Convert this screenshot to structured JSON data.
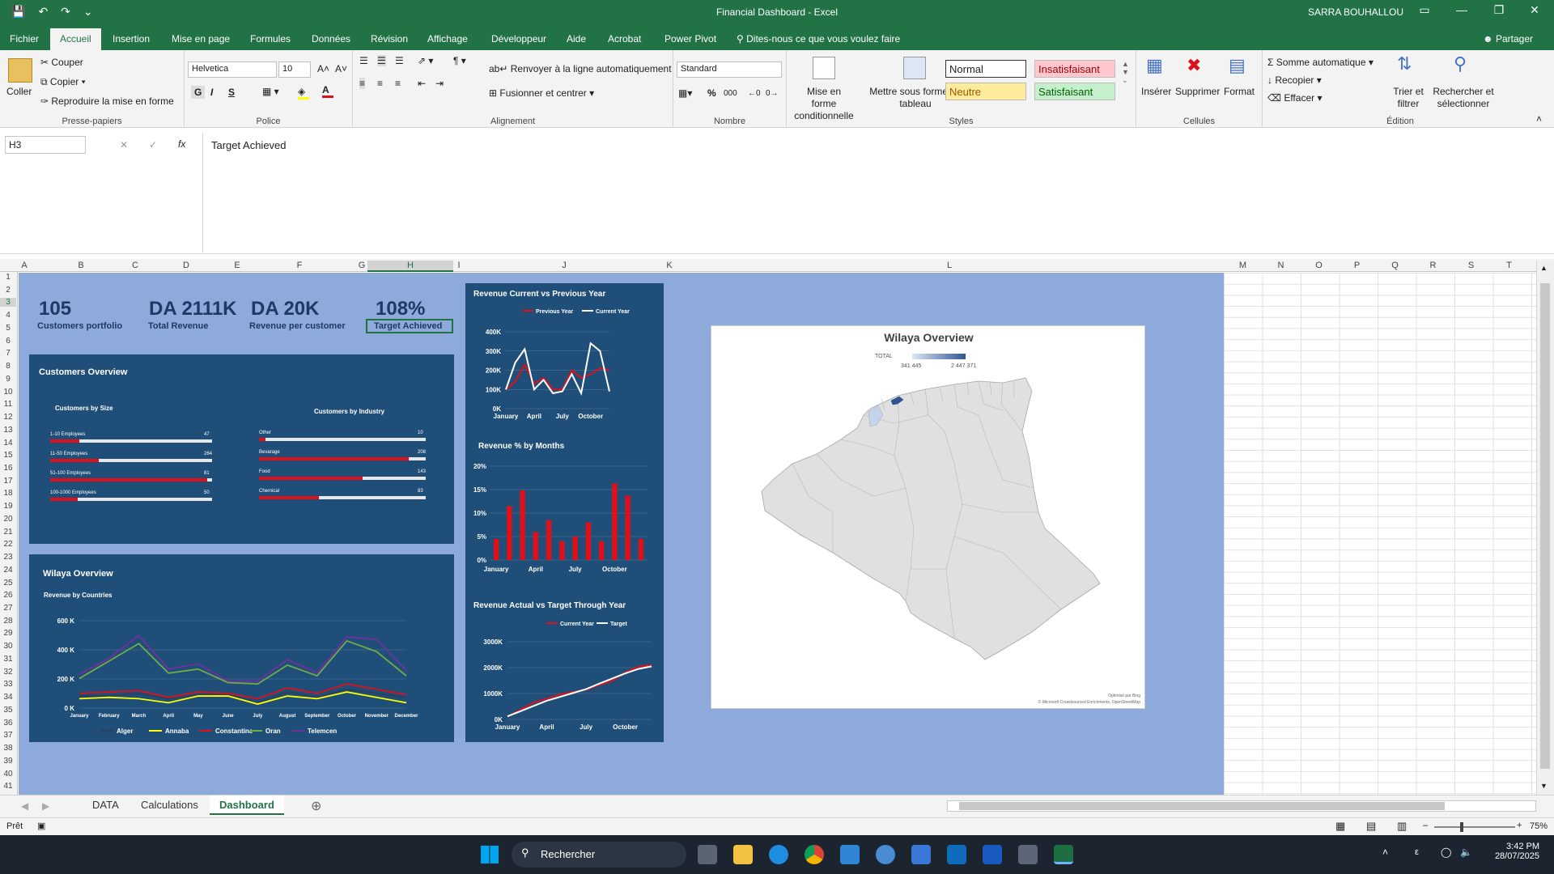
{
  "window": {
    "title": "Financial Dashboard  -  Excel",
    "user": "SARRA BOUHALLOU",
    "share": "Partager",
    "tell_me": "Dites-nous ce que vous voulez faire"
  },
  "menu": [
    "Fichier",
    "Accueil",
    "Insertion",
    "Mise en page",
    "Formules",
    "Données",
    "Révision",
    "Affichage",
    "Développeur",
    "Aide",
    "Acrobat",
    "Power Pivot"
  ],
  "ribbon": {
    "clipboard": {
      "paste": "Coller",
      "cut": "Couper",
      "copy": "Copier",
      "format_painter": "Reproduire la mise en forme",
      "label": "Presse-papiers"
    },
    "font": {
      "name": "Helvetica",
      "size": "10",
      "bold": "G",
      "italic": "I",
      "underline": "S",
      "label": "Police"
    },
    "alignment": {
      "wrap": "Renvoyer à la ligne automatiquement",
      "merge": "Fusionner et centrer",
      "label": "Alignement"
    },
    "number": {
      "format": "Standard",
      "label": "Nombre"
    },
    "styles": {
      "cond_format": "Mise en forme conditionnelle",
      "table_format": "Mettre sous forme de tableau",
      "normal": "Normal",
      "bad": "Insatisfaisant",
      "neutral": "Neutre",
      "good": "Satisfaisant",
      "label": "Styles"
    },
    "cells": {
      "insert": "Insérer",
      "delete": "Supprimer",
      "format": "Format",
      "label": "Cellules"
    },
    "editing": {
      "autosum": "Somme automatique",
      "fill": "Recopier",
      "clear": "Effacer",
      "sort": "Trier et filtrer",
      "find": "Rechercher et sélectionner",
      "label": "Édition"
    }
  },
  "formula_bar": {
    "name_box": "H3",
    "content": "Target Achieved"
  },
  "columns": [
    "A",
    "B",
    "C",
    "D",
    "E",
    "F",
    "G",
    "H",
    "I",
    "J",
    "K",
    "L",
    "M",
    "N",
    "O",
    "P",
    "Q",
    "R",
    "S",
    "T"
  ],
  "rows": [
    "1",
    "2",
    "3",
    "4",
    "5",
    "6",
    "7",
    "8",
    "9",
    "10",
    "11",
    "12",
    "13",
    "14",
    "15",
    "16",
    "17",
    "18",
    "19",
    "20",
    "21",
    "22",
    "23",
    "24",
    "25",
    "26",
    "27",
    "28",
    "29",
    "30",
    "31",
    "32",
    "33",
    "34",
    "35",
    "36",
    "37",
    "38",
    "39",
    "40",
    "41"
  ],
  "kpis": [
    {
      "value": "105",
      "label": "Customers portfolio"
    },
    {
      "value": "DA 2111K",
      "label": "Total Revenue"
    },
    {
      "value": "DA 20K",
      "label": "Revenue per customer"
    },
    {
      "value": "108%",
      "label": "Target Achieved"
    }
  ],
  "customers_overview": {
    "title": "Customers Overview",
    "by_size": {
      "title": "Customers by Size",
      "items": [
        {
          "label": "1-10 Employees",
          "value": "47",
          "fill": 0.18
        },
        {
          "label": "11-50 Employees",
          "value": "264",
          "fill": 0.3
        },
        {
          "label": "51-100 Employees",
          "value": "81",
          "fill": 0.97
        },
        {
          "label": "100-1000 Employees",
          "value": "50",
          "fill": 0.17
        }
      ]
    },
    "by_industry": {
      "title": "Customers by Industry",
      "items": [
        {
          "label": "Other",
          "value": "10",
          "fill": 0.04
        },
        {
          "label": "Bevarage",
          "value": "208",
          "fill": 0.9
        },
        {
          "label": "Food",
          "value": "143",
          "fill": 0.62
        },
        {
          "label": "Chemical",
          "value": "83",
          "fill": 0.36
        }
      ]
    }
  },
  "wilaya_panel": {
    "title": "Wilaya Overview"
  },
  "map": {
    "title": "Wilaya Overview",
    "legend": "TOTAL",
    "min": "341 445",
    "max": "2 447 371",
    "credit1": "Optimisé par Bing",
    "credit2": "© Microsoft Crowdsourced Enrichments, OpenStreetMap"
  },
  "chart_data": [
    {
      "type": "line",
      "title": "Revenue by Countries",
      "categories": [
        "January",
        "February",
        "March",
        "April",
        "May",
        "June",
        "July",
        "August",
        "September",
        "October",
        "November",
        "December"
      ],
      "yticks": [
        "0 K",
        "200 K",
        "400 K",
        "600 K"
      ],
      "ylim": [
        0,
        650000
      ],
      "series": [
        {
          "name": "Alger",
          "color": "#2e3f5a",
          "values": [
            90000,
            90000,
            110000,
            70000,
            100000,
            100000,
            40000,
            120000,
            80000,
            140000,
            110000,
            80000
          ]
        },
        {
          "name": "Annaba",
          "color": "#ffff00",
          "values": [
            70000,
            80000,
            70000,
            40000,
            90000,
            90000,
            30000,
            90000,
            70000,
            120000,
            80000,
            40000
          ]
        },
        {
          "name": "Constantine",
          "color": "#e0101a",
          "values": [
            110000,
            120000,
            130000,
            80000,
            120000,
            110000,
            70000,
            150000,
            110000,
            180000,
            140000,
            100000
          ]
        },
        {
          "name": "Oran",
          "color": "#70ad47",
          "values": [
            220000,
            350000,
            480000,
            260000,
            290000,
            190000,
            180000,
            320000,
            240000,
            500000,
            420000,
            240000
          ]
        },
        {
          "name": "Telemcen",
          "color": "#7030a0",
          "values": [
            250000,
            370000,
            540000,
            290000,
            330000,
            200000,
            200000,
            360000,
            260000,
            530000,
            510000,
            280000
          ]
        }
      ],
      "legend": "bottom"
    },
    {
      "type": "line",
      "title": "Revenue Current vs Previous Year",
      "categories": [
        "January",
        "February",
        "March",
        "April",
        "May",
        "June",
        "July",
        "August",
        "September",
        "October",
        "November",
        "December"
      ],
      "xticks": [
        "January",
        "April",
        "July",
        "October"
      ],
      "yticks": [
        "0K",
        "100K",
        "200K",
        "300K",
        "400K"
      ],
      "ylim": [
        0,
        400000
      ],
      "series": [
        {
          "name": "Previous Year",
          "color": "#e0101a",
          "values": [
            100000,
            140000,
            230000,
            130000,
            160000,
            100000,
            100000,
            200000,
            160000,
            180000,
            210000,
            200000
          ]
        },
        {
          "name": "Current Year",
          "color": "#ffffff",
          "values": [
            100000,
            240000,
            310000,
            100000,
            150000,
            80000,
            90000,
            180000,
            80000,
            340000,
            300000,
            90000
          ]
        }
      ],
      "legend": "top-right"
    },
    {
      "type": "bar",
      "title": "Revenue % by Months",
      "categories": [
        "January",
        "February",
        "March",
        "April",
        "May",
        "June",
        "July",
        "August",
        "September",
        "October",
        "November",
        "December"
      ],
      "xticks": [
        "January",
        "April",
        "July",
        "October"
      ],
      "yticks": [
        "0%",
        "5%",
        "10%",
        "15%",
        "20%"
      ],
      "ylim": [
        0,
        20
      ],
      "values": [
        4.5,
        11.5,
        14.8,
        6,
        8.5,
        4,
        5,
        8,
        4,
        16.3,
        13.7,
        4.5
      ],
      "color": "#e0101a"
    },
    {
      "type": "line",
      "title": "Revenue Actual vs Target Through Year",
      "categories": [
        "January",
        "February",
        "March",
        "April",
        "May",
        "June",
        "July",
        "August",
        "September",
        "October",
        "November",
        "December"
      ],
      "xticks": [
        "January",
        "April",
        "July",
        "October"
      ],
      "yticks": [
        "0K",
        "1000K",
        "2000K",
        "3000K"
      ],
      "ylim": [
        0,
        3000000
      ],
      "series": [
        {
          "name": "Current Year",
          "color": "#e0101a",
          "values": [
            100000,
            370000,
            650000,
            800000,
            960000,
            1060000,
            1150000,
            1330000,
            1490000,
            1820000,
            2030000,
            2111000
          ]
        },
        {
          "name": "Target",
          "color": "#ffffff",
          "values": [
            120000,
            320000,
            520000,
            720000,
            870000,
            1020000,
            1170000,
            1380000,
            1580000,
            1780000,
            1950000,
            2050000
          ]
        }
      ],
      "legend": "top-right"
    }
  ],
  "sheet_tabs": [
    "DATA",
    "Calculations",
    "Dashboard"
  ],
  "status": {
    "ready": "Prêt",
    "zoom": "75%"
  },
  "taskbar": {
    "search": "Rechercher",
    "time": "3:42 PM",
    "date": "28/07/2025"
  }
}
